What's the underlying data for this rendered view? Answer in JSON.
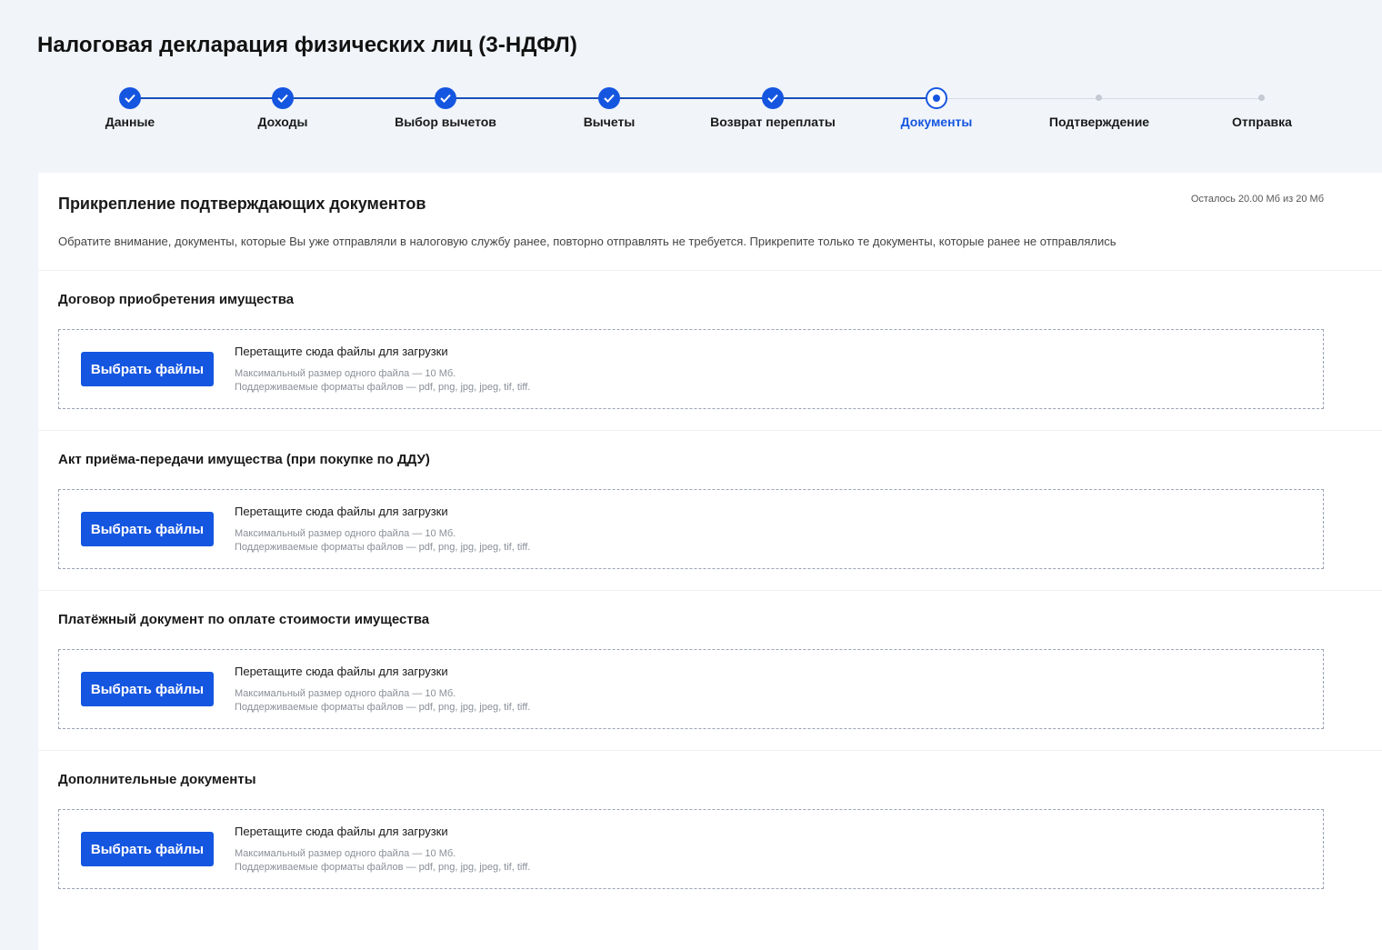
{
  "page_title": "Налоговая декларация физических лиц (3-НДФЛ)",
  "stepper": {
    "accent_color": "#1556e0",
    "steps": [
      {
        "label": "Данные",
        "status": "done"
      },
      {
        "label": "Доходы",
        "status": "done"
      },
      {
        "label": "Выбор вычетов",
        "status": "done"
      },
      {
        "label": "Вычеты",
        "status": "done"
      },
      {
        "label": "Возврат переплаты",
        "status": "done"
      },
      {
        "label": "Документы",
        "status": "current"
      },
      {
        "label": "Подтверждение",
        "status": "todo"
      },
      {
        "label": "Отправка",
        "status": "todo"
      }
    ]
  },
  "card": {
    "title": "Прикрепление подтверждающих документов",
    "quota": "Осталось 20.00 Мб из 20 Мб",
    "notice": "Обратите внимание, документы, которые Вы уже отправляли в налоговую службу ранее, повторно отправлять не требуется. Прикрепите только те документы, которые ранее не отправлялись"
  },
  "sections": [
    {
      "title": "Договор приобретения имущества",
      "button": "Выбрать файлы",
      "drop_text": "Перетащите сюда файлы для загрузки",
      "max_size": "Максимальный размер одного файла — 10 Мб.",
      "formats": "Поддерживаемые форматы файлов — pdf, png, jpg, jpeg, tif, tiff."
    },
    {
      "title": "Акт приёма-передачи имущества (при покупке по ДДУ)",
      "button": "Выбрать файлы",
      "drop_text": "Перетащите сюда файлы для загрузки",
      "max_size": "Максимальный размер одного файла — 10 Мб.",
      "formats": "Поддерживаемые форматы файлов — pdf, png, jpg, jpeg, tif, tiff."
    },
    {
      "title": "Платёжный документ по оплате стоимости имущества",
      "button": "Выбрать файлы",
      "drop_text": "Перетащите сюда файлы для загрузки",
      "max_size": "Максимальный размер одного файла — 10 Мб.",
      "formats": "Поддерживаемые форматы файлов — pdf, png, jpg, jpeg, tif, tiff."
    },
    {
      "title": "Дополнительные документы",
      "button": "Выбрать файлы",
      "drop_text": "Перетащите сюда файлы для загрузки",
      "max_size": "Максимальный размер одного файла — 10 Мб.",
      "formats": "Поддерживаемые форматы файлов — pdf, png, jpg, jpeg, tif, tiff."
    }
  ]
}
